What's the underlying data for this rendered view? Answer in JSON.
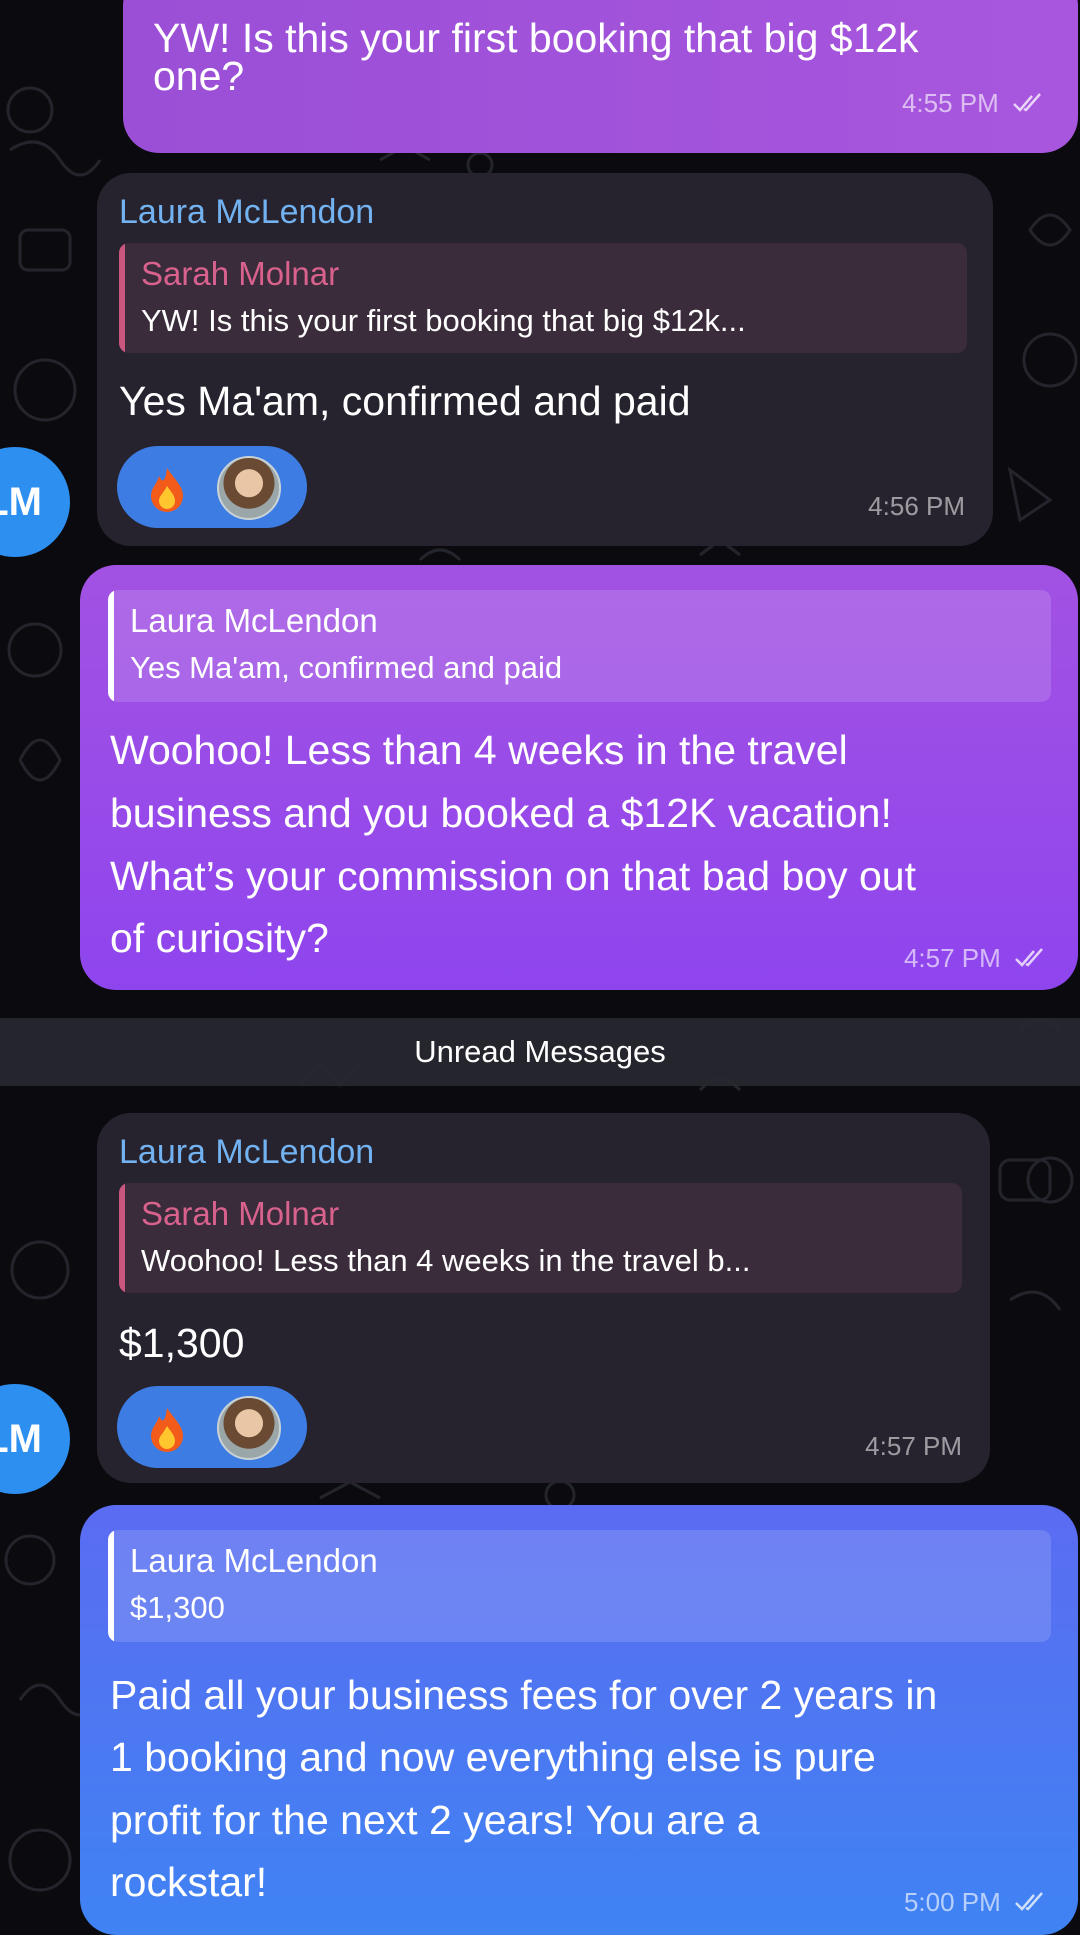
{
  "messages": [
    {
      "direction": "outgoing",
      "text_line1": "YW! Is this your first booking that big $12k",
      "text_line2": "one?",
      "time": "4:55 PM"
    },
    {
      "direction": "incoming",
      "sender": "Laura McLendon",
      "reply_name": "Sarah Molnar",
      "reply_text": "YW! Is this your first booking that big $12k...",
      "text": "Yes Ma'am, confirmed and paid",
      "reaction": "🔥",
      "time": "4:56 PM",
      "avatar_initials": "LM"
    },
    {
      "direction": "outgoing",
      "reply_name": "Laura McLendon",
      "reply_text": "Yes Ma'am, confirmed and paid",
      "text_line1": "Woohoo! Less than 4 weeks in the travel",
      "text_line2": "business and you booked a $12K vacation!",
      "text_line3": "What’s your commission on that bad boy out",
      "text_line4": "of curiosity?",
      "time": "4:57 PM"
    },
    {
      "direction": "incoming",
      "sender": "Laura McLendon",
      "reply_name": "Sarah Molnar",
      "reply_text": "Woohoo! Less than 4 weeks in the travel b...",
      "text": "$1,300",
      "reaction": "🔥",
      "time": "4:57 PM",
      "avatar_initials": "LM"
    },
    {
      "direction": "outgoing",
      "reply_name": "Laura McLendon",
      "reply_text": "$1,300",
      "text_line1": "Paid all your business fees for over 2 years in",
      "text_line2": "1 booking and now everything else is pure",
      "text_line3": "profit for the next 2 years! You are a",
      "text_line4": "rockstar!",
      "time": "5:00 PM"
    }
  ],
  "divider": "Unread Messages",
  "colors": {
    "background": "#0b0b0f",
    "incoming_bubble": "#26232e",
    "outgoing_purple": "#a252e2",
    "outgoing_blue": "#4f76f3",
    "sender_name": "#73b2f0",
    "reply_name_incoming": "#c9577f",
    "reaction_pill": "#3d7de3",
    "avatar": "#2d8ff0"
  },
  "icons": [
    "read-checkmarks-icon",
    "fire-reaction-icon",
    "reactor-avatar",
    "user-avatar"
  ]
}
